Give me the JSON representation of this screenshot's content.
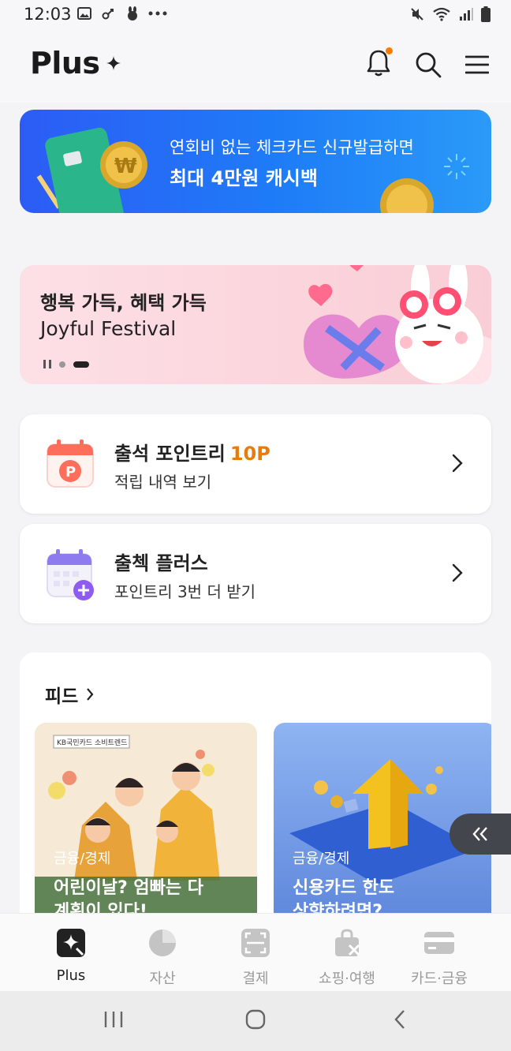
{
  "status": {
    "time": "12:03"
  },
  "header": {
    "logo": "Plus"
  },
  "banners": {
    "blue": {
      "line1": "연회비 없는 체크카드 신규발급하면",
      "line2": "최대 4만원 캐시백"
    },
    "pink": {
      "line1": "행복 가득, 혜택 가득",
      "line2": "Joyful Festival"
    }
  },
  "cards": {
    "attendance": {
      "title": "출석 포인트리",
      "points": "10P",
      "sub": "적립 내역 보기"
    },
    "checkplus": {
      "title": "출첵 플러스",
      "sub": "포인트리 3번 더 받기"
    }
  },
  "feed": {
    "heading": "피드",
    "items": [
      {
        "badge": "KB국민카드 소비트렌드",
        "category": "금융/경제",
        "title_line1": "어린이날? 엄빠는 다",
        "title_line2": "계획이 있다!"
      },
      {
        "category": "금융/경제",
        "title_line1": "신용카드 한도",
        "title_line2": "상향하려면?"
      }
    ]
  },
  "tabs": [
    {
      "label": "Plus",
      "icon": "sparkle-card-icon"
    },
    {
      "label": "자산",
      "icon": "pie-chart-icon"
    },
    {
      "label": "결제",
      "icon": "scan-icon"
    },
    {
      "label": "쇼핑·여행",
      "icon": "shopping-bag-icon"
    },
    {
      "label": "카드·금융",
      "icon": "card-icon"
    }
  ],
  "colors": {
    "accent": "#e87b0c",
    "notification": "#ff7a00",
    "banner_blue": "#1e7cf7",
    "banner_pink": "#fbd4dc"
  }
}
